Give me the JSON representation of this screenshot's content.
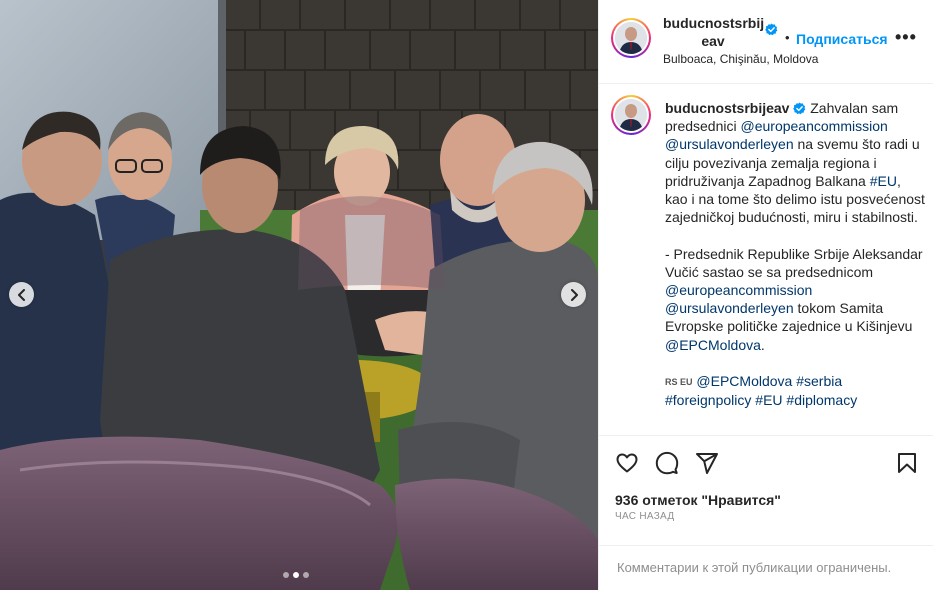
{
  "post": {
    "username": "buducnostsrbijeav",
    "username_line1": "buducnostsrbij",
    "username_line2": "eav",
    "separator": "•",
    "follow_label": "Подписаться",
    "more_label": "•••",
    "location": "Bulboaca, Chişinău, Moldova",
    "photo_alt": "Leaders seated in a circle on purple lounge chairs around a small yellow table in front of a dark wooden shingle wall",
    "carousel": {
      "dots": 3,
      "active": 1
    }
  },
  "caption": {
    "username": "buducnostsrbijeav",
    "p1_a": " Zahvalan sam predsednici ",
    "link1": "@europeancommission",
    "p1_b": " ",
    "link2": "@ursulavonderleyen",
    "p1_c": " na svemu što radi u cilju povezivanja zemalja regiona i pridruživanja Zapadnog Balkana ",
    "link3": "#EU",
    "p1_d": ", kao i na tome što delimo istu posvećenost zajedničkoj budućnosti, miru i stabilnosti.",
    "p2_a": "- Predsednik Republike Srbije Aleksandar Vučić sastao se sa predsednicom ",
    "link4": "@europeancommission",
    "p2_b": " ",
    "link5": "@ursulavonderleyen",
    "p2_c": " tokom Samita Evropske političke zajednice u Kišinjevu ",
    "link6": "@EPCMoldova",
    "p2_d": ".",
    "flags": "RS EU",
    "link7": "@EPCMoldova",
    "link8": "#serbia",
    "link9": "#foreignpolicy",
    "link10": "#EU",
    "link11": "#diplomacy"
  },
  "actions": {
    "like_icon": "heart-icon",
    "comment_icon": "comment-icon",
    "share_icon": "share-icon",
    "save_icon": "bookmark-icon",
    "likes_text": "936 отметок \"Нравится\"",
    "time_text": "ЧАС НАЗАД"
  },
  "comments": {
    "disabled_text": "Комментарии к этой публикации ограничены."
  },
  "colors": {
    "accent": "#0095f6",
    "link": "#00376b",
    "muted": "#8e8e8e"
  }
}
